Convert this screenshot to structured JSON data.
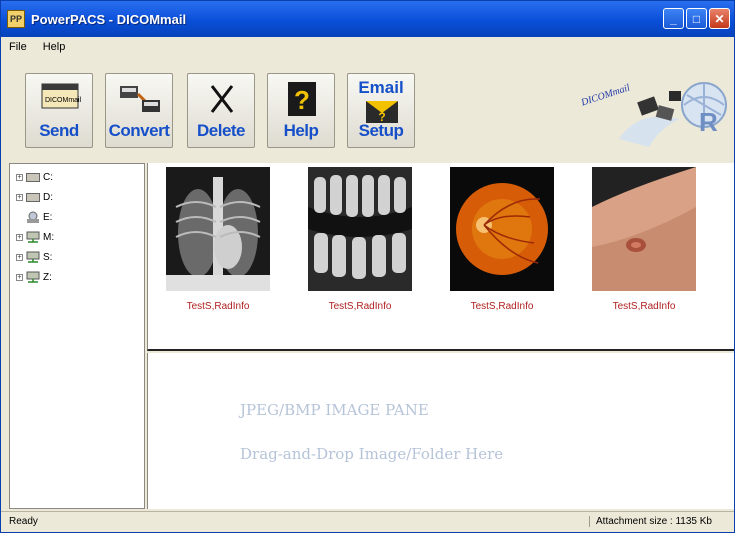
{
  "window": {
    "title": "PowerPACS - DICOMmail",
    "buttons": [
      "minimize",
      "maximize",
      "close"
    ]
  },
  "menu": [
    "File",
    "Help"
  ],
  "toolbar": [
    {
      "label": "Send",
      "icon": "send-icon"
    },
    {
      "label": "Convert",
      "icon": "convert-icon"
    },
    {
      "label": "Delete",
      "icon": "delete-icon"
    },
    {
      "label": "Help",
      "icon": "help-icon"
    },
    {
      "label": "Email Setup",
      "label_top": "Email",
      "label_bottom": "Setup",
      "icon": "email-setup-icon"
    }
  ],
  "logo": {
    "text": "DICOMmail"
  },
  "tree": [
    {
      "label": "C:",
      "icon": "drive-icon"
    },
    {
      "label": "D:",
      "icon": "drive-icon"
    },
    {
      "label": "E:",
      "icon": "cd-drive-icon"
    },
    {
      "label": "M:",
      "icon": "network-drive-icon"
    },
    {
      "label": "S:",
      "icon": "network-drive-icon"
    },
    {
      "label": "Z:",
      "icon": "network-drive-icon"
    }
  ],
  "thumbnails": [
    {
      "caption": "TestS,RadInfo",
      "image": "chest-xray"
    },
    {
      "caption": "TestS,RadInfo",
      "image": "dental-xray"
    },
    {
      "caption": "TestS,RadInfo",
      "image": "retina-fundus"
    },
    {
      "caption": "TestS,RadInfo",
      "image": "skin-lesion-photo"
    }
  ],
  "image_pane": {
    "title": "JPEG/BMP IMAGE PANE",
    "hint": "Drag-and-Drop Image/Folder Here"
  },
  "status": {
    "left": "Ready",
    "right": "Attachment size : 1135 Kb"
  },
  "colors": {
    "titlebar": "#0a4fd8",
    "toolbar_label": "#1650c9",
    "caption": "#b02020",
    "pane_text": "#b6c4d8"
  }
}
